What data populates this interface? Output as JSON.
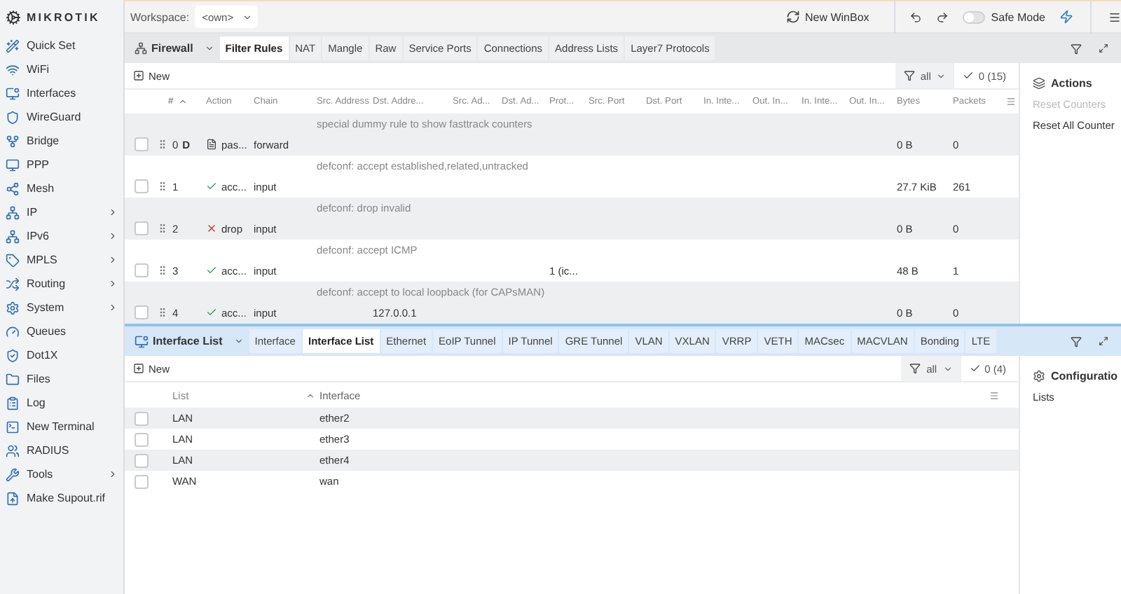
{
  "logo": "MIKROTIK",
  "sidebar": {
    "items": [
      {
        "label": "Quick Set",
        "submenu": false
      },
      {
        "label": "WiFi",
        "submenu": false
      },
      {
        "label": "Interfaces",
        "submenu": false
      },
      {
        "label": "WireGuard",
        "submenu": false
      },
      {
        "label": "Bridge",
        "submenu": false
      },
      {
        "label": "PPP",
        "submenu": false
      },
      {
        "label": "Mesh",
        "submenu": false
      },
      {
        "label": "IP",
        "submenu": true
      },
      {
        "label": "IPv6",
        "submenu": true
      },
      {
        "label": "MPLS",
        "submenu": true
      },
      {
        "label": "Routing",
        "submenu": true
      },
      {
        "label": "System",
        "submenu": true
      },
      {
        "label": "Queues",
        "submenu": false
      },
      {
        "label": "Dot1X",
        "submenu": false
      },
      {
        "label": "Files",
        "submenu": false
      },
      {
        "label": "Log",
        "submenu": false
      },
      {
        "label": "New Terminal",
        "submenu": false
      },
      {
        "label": "RADIUS",
        "submenu": false
      },
      {
        "label": "Tools",
        "submenu": true
      },
      {
        "label": "Make Supout.rif",
        "submenu": false
      }
    ]
  },
  "topbar": {
    "workspace_label": "Workspace:",
    "workspace_value": "<own>",
    "new_winbox": "New WinBox",
    "safe_mode": {
      "label": "Safe Mode",
      "on": false
    }
  },
  "firewall": {
    "title": "Firewall",
    "tabs": [
      {
        "label": "Filter Rules",
        "selected": true
      },
      {
        "label": "NAT",
        "selected": false
      },
      {
        "label": "Mangle",
        "selected": false
      },
      {
        "label": "Raw",
        "selected": false
      },
      {
        "label": "Service Ports",
        "selected": false
      },
      {
        "label": "Connections",
        "selected": false
      },
      {
        "label": "Address Lists",
        "selected": false
      },
      {
        "label": "Layer7 Protocols",
        "selected": false
      }
    ],
    "new": "New",
    "filter": "all",
    "count": "0 (15)",
    "columns": [
      {
        "label": "#",
        "sorted": true
      },
      {
        "label": "Action",
        "sorted": false
      },
      {
        "label": "Chain",
        "sorted": false
      },
      {
        "label": "Src. Address",
        "sorted": false
      },
      {
        "label": "Dst. Addre...",
        "sorted": false
      },
      {
        "label": "Src. Ad...",
        "sorted": false
      },
      {
        "label": "Dst. Ad...",
        "sorted": false
      },
      {
        "label": "Prot...",
        "sorted": false
      },
      {
        "label": "Src. Port",
        "sorted": false
      },
      {
        "label": "Dst. Port",
        "sorted": false
      },
      {
        "label": "In. Inte...",
        "sorted": false
      },
      {
        "label": "Out. In...",
        "sorted": false
      },
      {
        "label": "In. Inte...",
        "sorted": false
      },
      {
        "label": "Out. In...",
        "sorted": false
      },
      {
        "label": "Bytes",
        "sorted": false
      },
      {
        "label": "Packets",
        "sorted": false
      }
    ],
    "rows": [
      {
        "comment": "special dummy rule to show fasttrack counters",
        "checked": false,
        "flag": "D",
        "kind": "passthrough",
        "cells": [
          "0",
          "pas...",
          "forward",
          null,
          null,
          null,
          null,
          null,
          null,
          null,
          null,
          null,
          null,
          null,
          "0 B",
          "0"
        ]
      },
      {
        "comment": "defconf: accept established,related,untracked",
        "checked": false,
        "kind": "accept",
        "cells": [
          "1",
          "acc...",
          "input",
          null,
          null,
          null,
          null,
          null,
          null,
          null,
          null,
          null,
          null,
          null,
          "27.7 KiB",
          "261"
        ]
      },
      {
        "comment": "defconf: drop invalid",
        "checked": false,
        "kind": "drop",
        "cells": [
          "2",
          "drop",
          "input",
          null,
          null,
          null,
          null,
          null,
          null,
          null,
          null,
          null,
          null,
          null,
          "0 B",
          "0"
        ]
      },
      {
        "comment": "defconf: accept ICMP",
        "checked": false,
        "kind": "accept",
        "cells": [
          "3",
          "acc...",
          "input",
          null,
          null,
          null,
          null,
          "1 (ic...",
          null,
          null,
          null,
          null,
          null,
          null,
          "48 B",
          "1"
        ]
      },
      {
        "comment": "defconf: accept to local loopback (for CAPsMAN)",
        "checked": false,
        "kind": "accept",
        "cells": [
          "4",
          "acc...",
          "input",
          null,
          "127.0.0.1",
          null,
          null,
          null,
          null,
          null,
          null,
          null,
          null,
          null,
          "0 B",
          "0"
        ]
      }
    ],
    "side": {
      "title": "Actions",
      "items": [
        {
          "label": "Reset Counters",
          "disabled": true
        },
        {
          "label": "Reset All Counter",
          "disabled": false
        }
      ]
    }
  },
  "interface_list": {
    "title": "Interface List",
    "tabs": [
      {
        "label": "Interface",
        "selected": false
      },
      {
        "label": "Interface List",
        "selected": true
      },
      {
        "label": "Ethernet",
        "selected": false
      },
      {
        "label": "EoIP Tunnel",
        "selected": false
      },
      {
        "label": "IP Tunnel",
        "selected": false
      },
      {
        "label": "GRE Tunnel",
        "selected": false
      },
      {
        "label": "VLAN",
        "selected": false
      },
      {
        "label": "VXLAN",
        "selected": false
      },
      {
        "label": "VRRP",
        "selected": false
      },
      {
        "label": "VETH",
        "selected": false
      },
      {
        "label": "MACsec",
        "selected": false
      },
      {
        "label": "MACVLAN",
        "selected": false
      },
      {
        "label": "Bonding",
        "selected": false
      },
      {
        "label": "LTE",
        "selected": false
      }
    ],
    "new": "New",
    "filter": "all",
    "count": "0 (4)",
    "columns": [
      {
        "label": "List",
        "sorted": false
      },
      {
        "label": "Interface",
        "sorted": true
      }
    ],
    "rows": [
      {
        "checked": false,
        "cells": [
          "LAN",
          "ether2"
        ]
      },
      {
        "checked": false,
        "cells": [
          "LAN",
          "ether3"
        ]
      },
      {
        "checked": false,
        "cells": [
          "LAN",
          "ether4"
        ]
      },
      {
        "checked": false,
        "cells": [
          "WAN",
          "wan"
        ]
      }
    ],
    "side": {
      "title": "Configuratio",
      "items": [
        {
          "label": "Lists",
          "disabled": false
        }
      ]
    }
  }
}
